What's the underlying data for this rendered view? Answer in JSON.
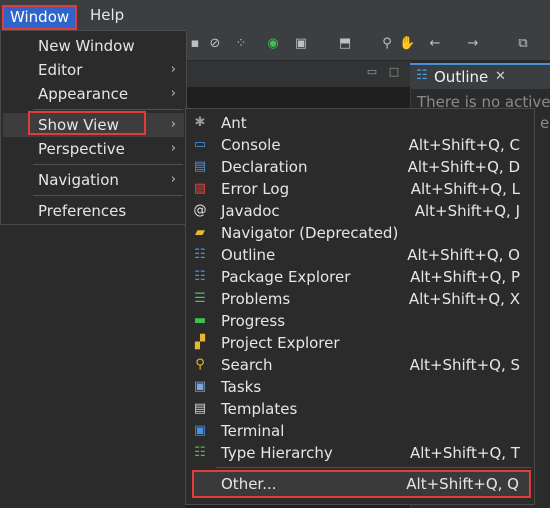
{
  "menubar": {
    "window": "Window",
    "help": "Help"
  },
  "toolbar_icons": [
    "nav-icon",
    "link-icon",
    "debug-icon",
    "run-icon",
    "new-icon",
    "annotation-icon",
    "pin-icon",
    "back-icon",
    "forward-icon",
    "restore-icon"
  ],
  "outline": {
    "tab_title": "Outline",
    "close_glyph": "✕",
    "message": "There is no active e",
    "message_cont": "e"
  },
  "window_menu": [
    {
      "label": "New Window",
      "submenu": false
    },
    {
      "label": "Editor",
      "submenu": true
    },
    {
      "label": "Appearance",
      "submenu": true
    },
    {
      "label": "Show View",
      "submenu": true
    },
    {
      "label": "Perspective",
      "submenu": true
    },
    {
      "label": "Navigation",
      "submenu": true
    },
    {
      "label": "Preferences",
      "submenu": false
    }
  ],
  "show_view": [
    {
      "label": "Ant",
      "shortcut": "",
      "icon": "ant-icon",
      "color": "#9a9a9a"
    },
    {
      "label": "Console",
      "shortcut": "Alt+Shift+Q, C",
      "icon": "console-icon",
      "color": "#4a90e2"
    },
    {
      "label": "Declaration",
      "shortcut": "Alt+Shift+Q, D",
      "icon": "declaration-icon",
      "color": "#4a90e2"
    },
    {
      "label": "Error Log",
      "shortcut": "Alt+Shift+Q, L",
      "icon": "error-log-icon",
      "color": "#e04545"
    },
    {
      "label": "Javadoc",
      "shortcut": "Alt+Shift+Q, J",
      "icon": "javadoc-icon",
      "color": "#e6e6e6"
    },
    {
      "label": "Navigator (Deprecated)",
      "shortcut": "",
      "icon": "navigator-icon",
      "color": "#e8b82a"
    },
    {
      "label": "Outline",
      "shortcut": "Alt+Shift+Q, O",
      "icon": "outline-icon",
      "color": "#4a90e2"
    },
    {
      "label": "Package Explorer",
      "shortcut": "Alt+Shift+Q, P",
      "icon": "package-explorer-icon",
      "color": "#4a90e2"
    },
    {
      "label": "Problems",
      "shortcut": "Alt+Shift+Q, X",
      "icon": "problems-icon",
      "color": "#5cb85c"
    },
    {
      "label": "Progress",
      "shortcut": "",
      "icon": "progress-icon",
      "color": "#3cc24a"
    },
    {
      "label": "Project Explorer",
      "shortcut": "",
      "icon": "project-explorer-icon",
      "color": "#e8b82a"
    },
    {
      "label": "Search",
      "shortcut": "Alt+Shift+Q, S",
      "icon": "search-icon",
      "color": "#e8b82a"
    },
    {
      "label": "Tasks",
      "shortcut": "",
      "icon": "tasks-icon",
      "color": "#7aa7d8"
    },
    {
      "label": "Templates",
      "shortcut": "",
      "icon": "templates-icon",
      "color": "#d0d0d0"
    },
    {
      "label": "Terminal",
      "shortcut": "",
      "icon": "terminal-icon",
      "color": "#4a90e2"
    },
    {
      "label": "Type Hierarchy",
      "shortcut": "Alt+Shift+Q, T",
      "icon": "type-hierarchy-icon",
      "color": "#5cb85c"
    }
  ],
  "other": {
    "label": "Other...",
    "shortcut": "Alt+Shift+Q, Q"
  },
  "colors": {
    "menu_bg": "#2b2b2b",
    "highlight": "#2f65ca",
    "annotation": "#e23b3b"
  }
}
